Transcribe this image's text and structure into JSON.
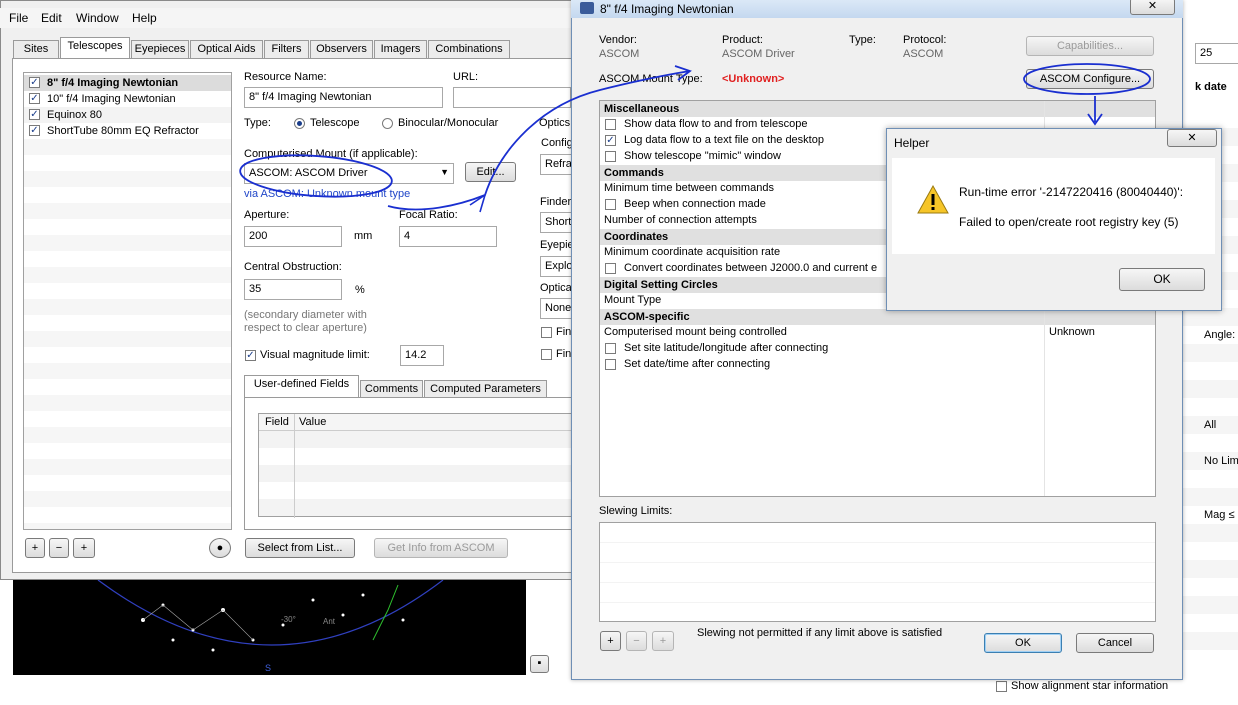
{
  "menu": [
    "File",
    "Edit",
    "Window",
    "Help"
  ],
  "tabs": [
    "Sites",
    "Telescopes",
    "Eyepieces",
    "Optical Aids",
    "Filters",
    "Observers",
    "Imagers",
    "Combinations"
  ],
  "telescopes": [
    {
      "name": "8\" f/4 Imaging Newtonian",
      "checked": true,
      "selected": true
    },
    {
      "name": "10\" f/4 Imaging Newtonian",
      "checked": true
    },
    {
      "name": "Equinox 80",
      "checked": true
    },
    {
      "name": "ShortTube 80mm EQ Refractor",
      "checked": true
    }
  ],
  "form": {
    "resource_name_label": "Resource Name:",
    "resource_name": "8\" f/4 Imaging Newtonian",
    "url_label": "URL:",
    "type_label": "Type:",
    "type_telescope": "Telescope",
    "type_binocular": "Binocular/Monocular",
    "mount_label": "Computerised Mount (if applicable):",
    "mount_value": "ASCOM: ASCOM Driver",
    "edit_button": "Edit...",
    "mount_note": "via ASCOM: Unknown mount type",
    "aperture_label": "Aperture:",
    "aperture": "200",
    "aperture_unit": "mm",
    "focal_label": "Focal Ratio:",
    "focal": "4",
    "obstruction_label": "Central Obstruction:",
    "obstruction": "35",
    "obstruction_unit": "%",
    "obstruction_hint_1": "(secondary diameter with",
    "obstruction_hint_2": "respect to clear aperture)",
    "vis_mag_label": "Visual magnitude limit:",
    "vis_mag": "14.2",
    "optics_label": "Optics",
    "config_label": "Config",
    "refra": "Refra",
    "finder_label": "Finder",
    "short": "Short",
    "eyepiece_label": "Eyepie",
    "explo": "Explo",
    "optica_label": "Optica",
    "none": "None",
    "fin1": "Fin",
    "fin2": "Fin"
  },
  "subtabs": [
    "User-defined Fields",
    "Comments",
    "Computed Parameters"
  ],
  "fields_headers": [
    "Field",
    "Value"
  ],
  "bottom_buttons": {
    "select_list": "Select from List...",
    "get_info": "Get Info from ASCOM"
  },
  "dialog": {
    "title": "8\" f/4 Imaging Newtonian",
    "vendor_label": "Vendor:",
    "vendor": "ASCOM",
    "product_label": "Product:",
    "product": "ASCOM Driver",
    "type_label": "Type:",
    "protocol_label": "Protocol:",
    "protocol": "ASCOM",
    "capabilities_button": "Capabilities...",
    "mount_type_label": "ASCOM Mount Type:",
    "mount_type_value": "<Unknown>",
    "configure_button": "ASCOM Configure...",
    "sections": {
      "misc": "Miscellaneous",
      "commands": "Commands",
      "coordinates": "Coordinates",
      "dsc": "Digital Setting Circles",
      "ascom": "ASCOM-specific"
    },
    "props": {
      "show_data_flow": "Show data flow to and from telescope",
      "log_data_flow": "Log data flow to a text file on the desktop",
      "show_mimic": "Show telescope \"mimic\" window",
      "min_time": "Minimum time between commands",
      "beep": "Beep when connection made",
      "num_attempts": "Number of connection attempts",
      "min_coord": "Minimum coordinate acquisition rate",
      "convert_coord": "Convert coordinates between J2000.0 and current e",
      "mount_type": "Mount Type",
      "controlled": "Computerised mount being controlled",
      "controlled_value": "Unknown",
      "set_site": "Set site latitude/longitude after connecting",
      "set_date": "Set date/time after connecting"
    },
    "slewing_label": "Slewing Limits:",
    "slewing_note": "Slewing not permitted if any limit above is satisfied",
    "ok": "OK",
    "cancel": "Cancel"
  },
  "helper": {
    "title": "Helper",
    "error_line1": "Run-time error '-2147220416 (80040440)':",
    "error_line2": "Failed to open/create root registry key (5)",
    "ok": "OK"
  },
  "right_strip": {
    "num": "25",
    "date": "k date",
    "angle": "Angle:",
    "all": "All",
    "no_lim": "No Lim",
    "mag": "Mag ≤"
  },
  "alignment_label": "Show alignment star information",
  "sky_labels": {
    "ant": "Ant",
    "s": "S",
    "m30": "-30°"
  },
  "annotation_color": "#1a2fd0"
}
